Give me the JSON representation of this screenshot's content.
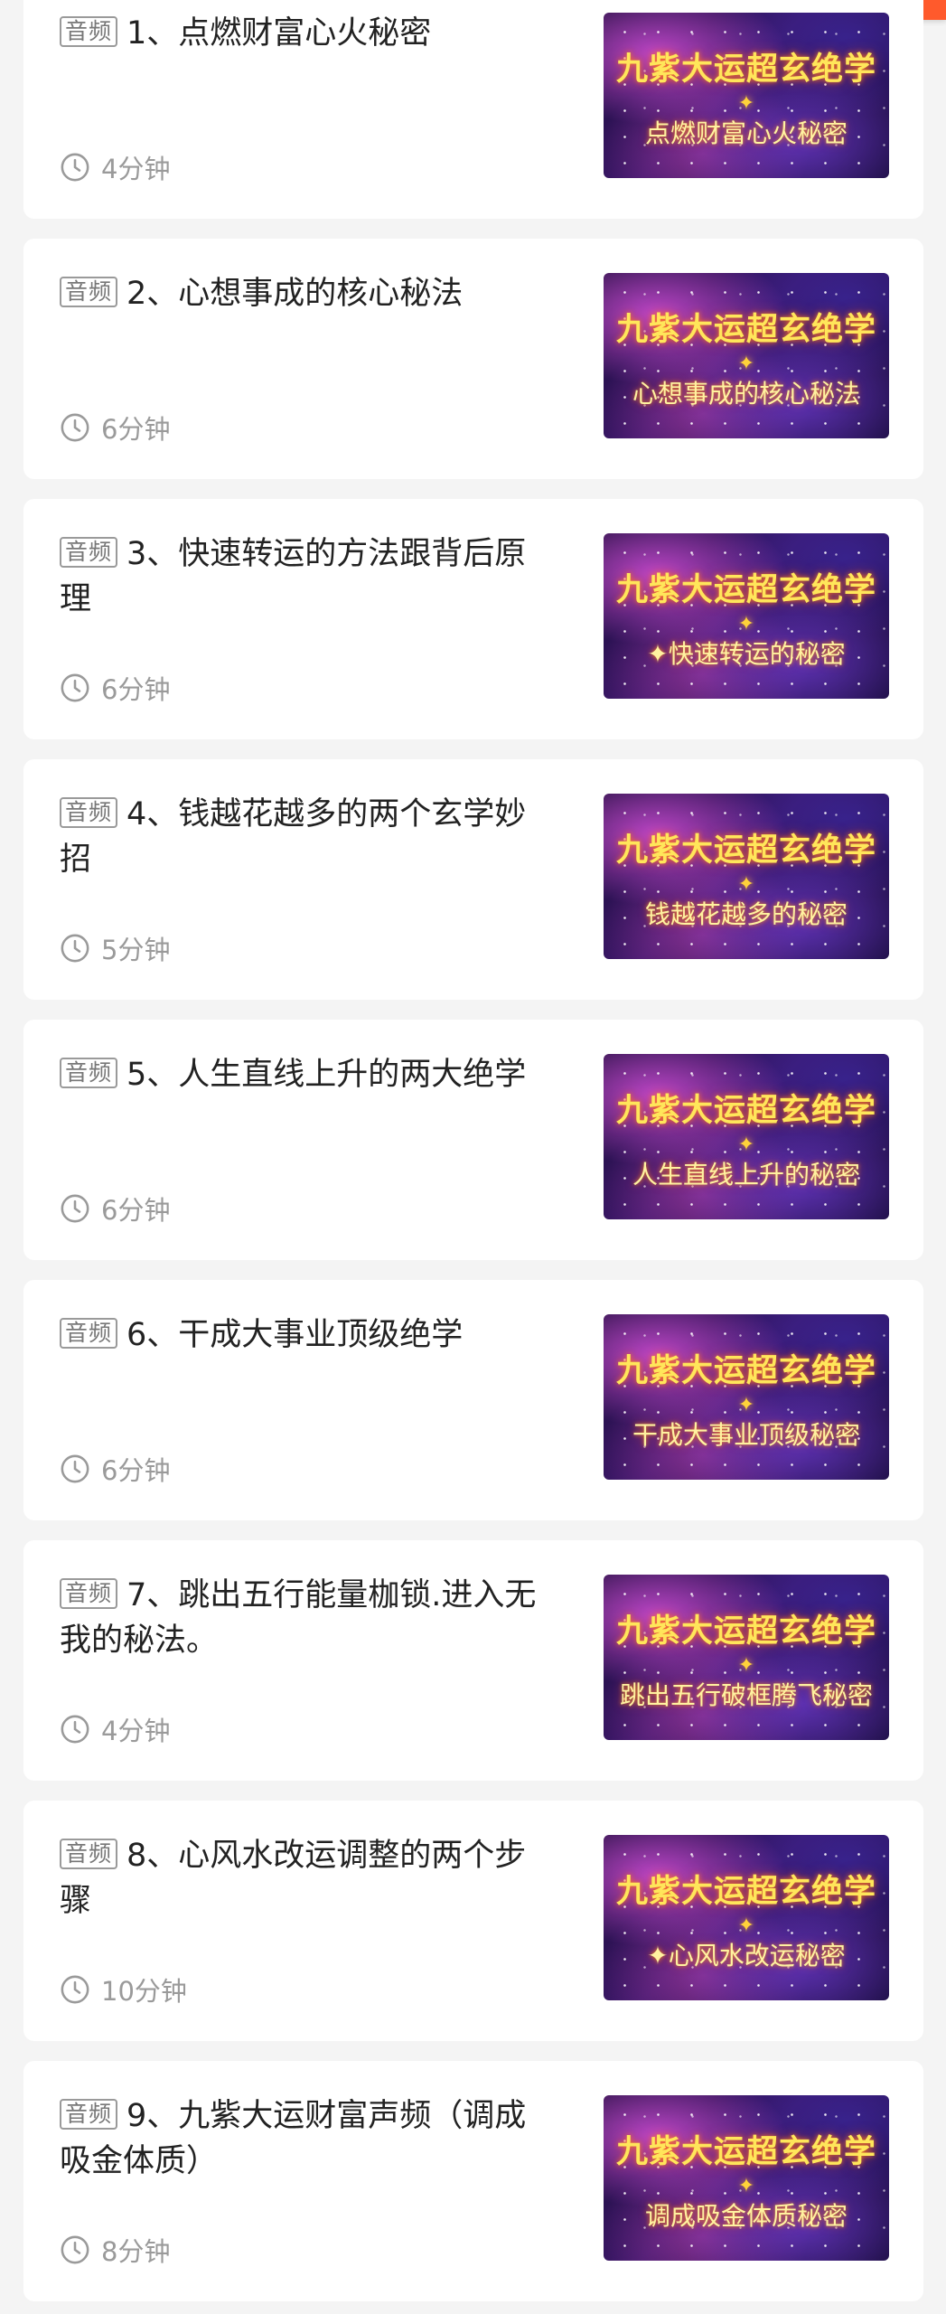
{
  "badge_label": "音频",
  "thumbnail_title": "九紫大运超玄绝学",
  "items": [
    {
      "title": "1、点燃财富心火秘密",
      "duration": "4分钟",
      "thumb_caption": "点燃财富心火秘密"
    },
    {
      "title": "2、心想事成的核心秘法",
      "duration": "6分钟",
      "thumb_caption": "心想事成的核心秘法"
    },
    {
      "title": "3、快速转运的方法跟背后原理",
      "duration": "6分钟",
      "thumb_caption": "✦快速转运的秘密"
    },
    {
      "title": "4、钱越花越多的两个玄学妙招",
      "duration": "5分钟",
      "thumb_caption": "钱越花越多的秘密"
    },
    {
      "title": "5、人生直线上升的两大绝学",
      "duration": "6分钟",
      "thumb_caption": "人生直线上升的秘密"
    },
    {
      "title": "6、干成大事业顶级绝学",
      "duration": "6分钟",
      "thumb_caption": "干成大事业顶级秘密"
    },
    {
      "title": "7、跳出五行能量枷锁.进入无我的秘法。",
      "duration": "4分钟",
      "thumb_caption": "跳出五行破框腾飞秘密"
    },
    {
      "title": "8、心风水改运调整的两个步骤",
      "duration": "10分钟",
      "thumb_caption": "✦心风水改运秘密"
    },
    {
      "title": "9、九紫大运财富声频（调成吸金体质）",
      "duration": "8分钟",
      "thumb_caption": "调成吸金体质秘密"
    }
  ],
  "colors": {
    "background": "#f4f4f4",
    "card": "#ffffff",
    "title_text": "#222222",
    "meta_text": "#9a9a9a",
    "thumb_title": "#ffe65a",
    "top_badge": "#ff5a2c"
  },
  "icons": {
    "duration": "clock-icon"
  }
}
